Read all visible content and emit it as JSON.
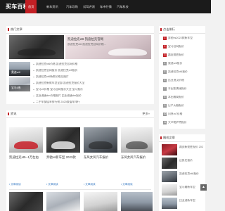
{
  "site": {
    "logo": "买车百科网"
  },
  "nav": {
    "items": [
      "首页",
      "新车资讯",
      "汽车导购",
      "试驾评测",
      "车市行情",
      "汽车科技"
    ]
  },
  "hot": {
    "title": "热门文章",
    "feature_title": "凯迪拉克xt6 凯迪拉克官网",
    "feature_desc": "凯迪拉克xt6 凯迪拉克官网价格…",
    "list": [
      "凯迪拉克xt6价格 凯迪拉克官网价格",
      "凯迪拉克官网报价 凯迪拉克xt5报价",
      "凯迪拉克xt6新款价格及图片",
      "凯迪拉克新款车型全部 凯迪拉克报价大全",
      "宝马x5价格 宝马官网报价大全 宝马报价",
      "比亚迪唐dm价格图片 比亚迪唐dm报价",
      "二手车保值率排行榜 2023保值车排行"
    ],
    "thumb_captions": [
      "奥迪a4l",
      "宝马5系"
    ]
  },
  "rank": {
    "title": "点击排行",
    "items": [
      "奔驰vs2022款新车型",
      "宝马官网报价",
      "路虎揽胜报价",
      "奥迪a4l报价",
      "凯迪拉克xt6报价",
      "比亚迪汉价格",
      "丰田凯美瑞报价",
      "本田雅阁报价",
      "日产天籁报价",
      "问界m7价格",
      "大众帕萨特报价"
    ],
    "numbers": [
      "1",
      "2",
      "3",
      "4",
      "5",
      "6",
      "7",
      "8",
      "9",
      "10",
      "11"
    ]
  },
  "news": {
    "title": "资讯",
    "more": "更多»",
    "cards": [
      {
        "title": "凯迪拉克xt5--1万左右",
        "tag": "• 文章阅读"
      },
      {
        "title": "奔驰vs新车型 2023款",
        "tag": "• 文章阅读"
      },
      {
        "title": "东风女风汽车报价",
        "tag": "• 文章阅读"
      },
      {
        "title": "东风女风汽车报价",
        "tag": "• 文章阅读"
      }
    ]
  },
  "latest": {
    "title": "随机文章",
    "items": [
      "路虎新揽胜报价 2023款路虎揽胜",
      "迈凯伦报价",
      "凯迪拉克xt6报价",
      "宝马最新车型",
      "比亚迪新车型"
    ]
  },
  "totop": "▲"
}
